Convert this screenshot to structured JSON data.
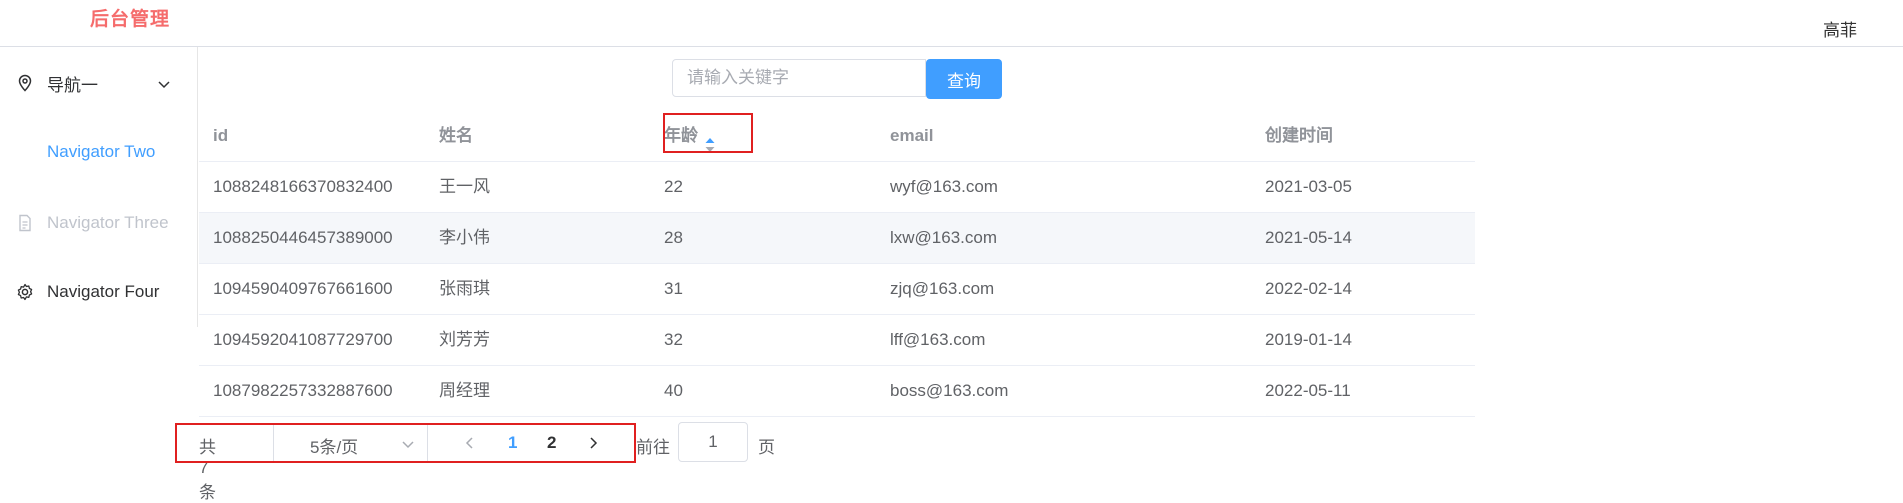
{
  "header": {
    "brand": "后台管理",
    "user": "高菲"
  },
  "sidebar": {
    "items": [
      {
        "label": "导航一",
        "icon": "location-pin-icon"
      },
      {
        "label": "Navigator Two",
        "icon": ""
      },
      {
        "label": "Navigator Three",
        "icon": "document-icon"
      },
      {
        "label": "Navigator Four",
        "icon": "gear-icon"
      }
    ]
  },
  "search": {
    "placeholder": "请输入关键字",
    "value": "",
    "button": "查询"
  },
  "table": {
    "columns": [
      "id",
      "姓名",
      "年龄",
      "email",
      "创建时间"
    ],
    "rows": [
      [
        "1088248166370832400",
        "王一风",
        "22",
        "wyf@163.com",
        "2021-03-05"
      ],
      [
        "1088250446457389000",
        "李小伟",
        "28",
        "lxw@163.com",
        "2021-05-14"
      ],
      [
        "1094590409767661600",
        "张雨琪",
        "31",
        "zjq@163.com",
        "2022-02-14"
      ],
      [
        "1094592041087729700",
        "刘芳芳",
        "32",
        "lff@163.com",
        "2019-01-14"
      ],
      [
        "1087982257332887600",
        "周经理",
        "40",
        "boss@163.com",
        "2022-05-11"
      ]
    ]
  },
  "pagination": {
    "total": "共 7 条",
    "page_size": "5条/页",
    "pages": [
      "1",
      "2"
    ],
    "current_page": "1",
    "goto_label": "前往",
    "goto_value": "1",
    "page_suffix": "页"
  },
  "colors": {
    "accent": "#409eff",
    "brand": "#f56c6c",
    "highlight": "#e02020"
  }
}
